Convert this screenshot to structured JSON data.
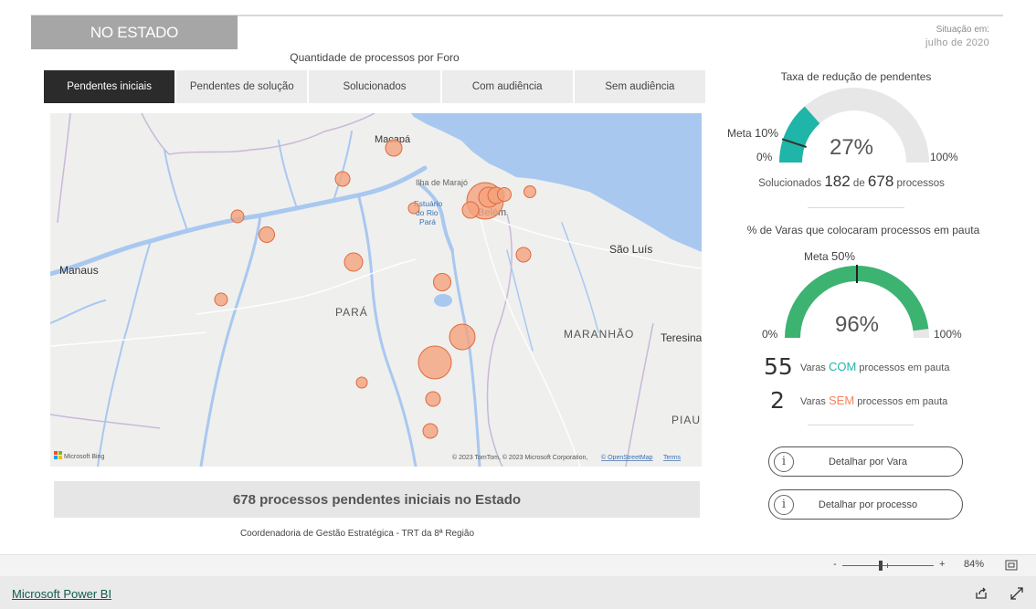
{
  "header": {
    "title": "NO ESTADO",
    "situacao_label": "Situação em:",
    "situacao_date": "julho de 2020"
  },
  "map_section": {
    "title": "Quantidade de processos por Foro",
    "tabs": [
      {
        "label": "Pendentes iniciais",
        "active": true
      },
      {
        "label": "Pendentes de solução",
        "active": false
      },
      {
        "label": "Solucionados",
        "active": false
      },
      {
        "label": "Com audiência",
        "active": false
      },
      {
        "label": "Sem audiência",
        "active": false
      }
    ],
    "places": {
      "macapa": "Macapá",
      "ilha": "Ilha de Marajó",
      "estuario": "Estuário",
      "do_rio": "do Rio",
      "para_small": "Pará",
      "belem": "Belém",
      "sao_luis": "São Luís",
      "manaus": "Manaus",
      "para": "PARÁ",
      "maranhao": "MARANHÃO",
      "teresina": "Teresina",
      "piaui": "PIAUÍ"
    },
    "bing": "Microsoft Bing",
    "copyright": "© 2023 TomTom, © 2023 Microsoft Corporation, ",
    "osm": "© OpenStreetMap",
    "terms": "Terms",
    "summary": "678 processos pendentes iniciais no Estado",
    "credit": "Coordenadoria de Gestão Estratégica - TRT da 8ª Região"
  },
  "gauge1": {
    "title": "Taxa de redução de pendentes",
    "value": 0.27,
    "value_label": "27%",
    "meta": 0.1,
    "meta_label": "Meta",
    "meta_value": "10%",
    "min_label": "0%",
    "max_label": "100%",
    "color": "#1fb5a8",
    "sol_pre": "Solucionados",
    "sol_num": "182",
    "sol_de": "de",
    "sol_total": "678",
    "sol_post": "processos"
  },
  "gauge2": {
    "title": "% de Varas que colocaram processos em pauta",
    "value": 0.96,
    "value_label": "96%",
    "meta": 0.5,
    "meta_label": "Meta",
    "meta_value": "50%",
    "min_label": "0%",
    "max_label": "100%",
    "color": "#3cb371"
  },
  "varas": {
    "com_num": "55",
    "com_pre": "Varas",
    "com_key": "COM",
    "com_post": "processos em pauta",
    "com_color": "#1fb5a8",
    "sem_num": "2",
    "sem_pre": "Varas",
    "sem_key": "SEM",
    "sem_post": "processos em pauta",
    "sem_color": "#f4845f"
  },
  "buttons": {
    "vara": "Detalhar por Vara",
    "processo": "Detalhar por processo",
    "info_icon": "i"
  },
  "statusbar": {
    "minus": "-",
    "plus": "+",
    "zoom": "84%"
  },
  "bottombar": {
    "link": "Microsoft Power BI"
  }
}
